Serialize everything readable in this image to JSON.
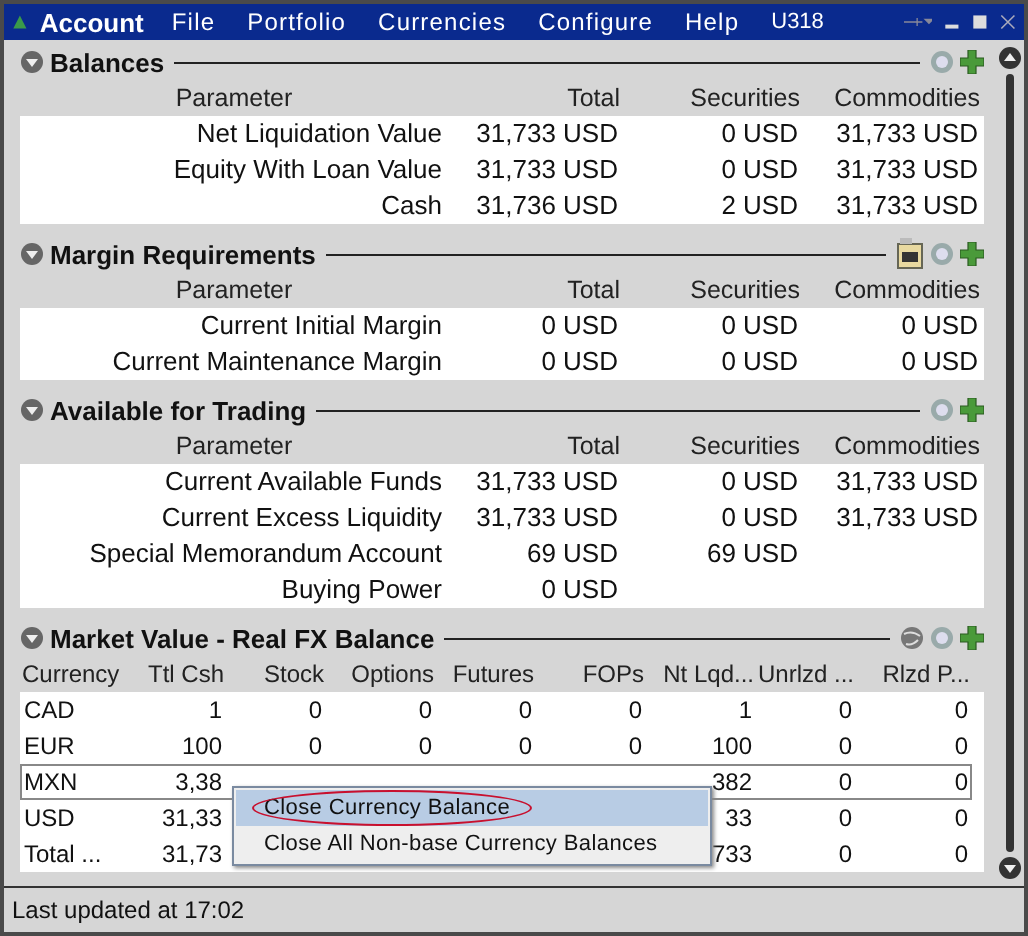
{
  "window": {
    "title": "Account",
    "account": "U318"
  },
  "menu": [
    {
      "label": "File"
    },
    {
      "label": "Portfolio"
    },
    {
      "label": "Currencies"
    },
    {
      "label": "Configure"
    },
    {
      "label": "Help"
    }
  ],
  "sections": [
    {
      "title": "Balances",
      "expanded": true,
      "tools": [
        {
          "kind": "help"
        },
        {
          "kind": "add"
        }
      ],
      "columns": [
        "Parameter",
        "Total",
        "Securities",
        "Commodities"
      ],
      "rows": [
        [
          "Net Liquidation Value",
          "31,733 USD",
          "0 USD",
          "31,733 USD"
        ],
        [
          "Equity With Loan Value",
          "31,733 USD",
          "0 USD",
          "31,733 USD"
        ],
        [
          "Cash",
          "31,736 USD",
          "2 USD",
          "31,733 USD"
        ]
      ]
    },
    {
      "title": "Margin Requirements",
      "expanded": true,
      "tools": [
        {
          "kind": "pm"
        },
        {
          "kind": "help"
        },
        {
          "kind": "add"
        }
      ],
      "columns": [
        "Parameter",
        "Total",
        "Securities",
        "Commodities"
      ],
      "rows": [
        [
          "Current Initial Margin",
          "0 USD",
          "0 USD",
          "0 USD"
        ],
        [
          "Current Maintenance Margin",
          "0 USD",
          "0 USD",
          "0 USD"
        ]
      ]
    },
    {
      "title": "Available for Trading",
      "expanded": true,
      "tools": [
        {
          "kind": "help"
        },
        {
          "kind": "add"
        }
      ],
      "columns": [
        "Parameter",
        "Total",
        "Securities",
        "Commodities"
      ],
      "rows": [
        [
          "Current Available Funds",
          "31,733 USD",
          "0 USD",
          "31,733 USD"
        ],
        [
          "Current Excess Liquidity",
          "31,733 USD",
          "0 USD",
          "31,733 USD"
        ],
        [
          "Special Memorandum Account",
          "69 USD",
          "69 USD",
          ""
        ],
        [
          "Buying Power",
          "0 USD",
          "",
          ""
        ]
      ]
    }
  ],
  "fx": {
    "title": "Market Value - Real FX Balance",
    "expanded": true,
    "tools": [
      {
        "kind": "globe"
      },
      {
        "kind": "help"
      },
      {
        "kind": "add"
      }
    ],
    "columns": [
      "Currency",
      "Ttl Csh",
      "Stock",
      "Options",
      "Futures",
      "FOPs",
      "Nt Lqd...",
      "Unrlzd ...",
      "Rlzd P..."
    ],
    "rows": [
      {
        "selected": false,
        "cells": [
          "CAD",
          "1",
          "0",
          "0",
          "0",
          "0",
          "1",
          "0",
          "0"
        ]
      },
      {
        "selected": false,
        "cells": [
          "EUR",
          "100",
          "0",
          "0",
          "0",
          "0",
          "100",
          "0",
          "0"
        ]
      },
      {
        "selected": true,
        "cells": [
          "MXN",
          "3,38",
          "",
          "",
          "",
          "",
          "382",
          "0",
          "0"
        ]
      },
      {
        "selected": false,
        "cells": [
          "USD",
          "31,33",
          "",
          "",
          "",
          "",
          "33",
          "0",
          "0"
        ]
      },
      {
        "selected": false,
        "cells": [
          "Total ...",
          "31,73",
          "",
          "",
          "",
          "",
          "733",
          "0",
          "0"
        ]
      }
    ]
  },
  "context_menu": [
    {
      "label": "Close Currency Balance",
      "selected": true,
      "circled": true
    },
    {
      "label": "Close All Non-base Currency Balances",
      "selected": false,
      "circled": false
    }
  ],
  "status_bar": "Last updated at 17:02"
}
